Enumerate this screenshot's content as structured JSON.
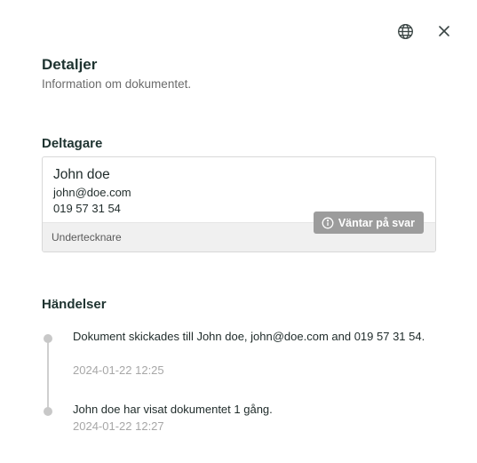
{
  "header": {
    "icons": [
      "globe-icon",
      "close-icon"
    ],
    "title": "Detaljer",
    "subtitle": "Information om dokumentet."
  },
  "participants": {
    "section_title": "Deltagare",
    "card": {
      "name": "John doe",
      "email": "john@doe.com",
      "phone": "019 57 31 54",
      "role": "Undertecknare",
      "status": "Väntar på svar",
      "status_icon": "info-icon"
    }
  },
  "events": {
    "section_title": "Händelser",
    "items": [
      {
        "text": "Dokument skickades till John doe, john@doe.com and 019 57 31 54.",
        "time": "2024-01-22 12:25"
      },
      {
        "text": "John doe har visat dokumentet 1 gång.",
        "time": "2024-01-22 12:27"
      }
    ]
  },
  "colors": {
    "heading": "#1e3330",
    "badge_bg": "#9c9c9c",
    "footer_bg": "#f0f0f0",
    "timestamp": "#a7a7a7"
  }
}
